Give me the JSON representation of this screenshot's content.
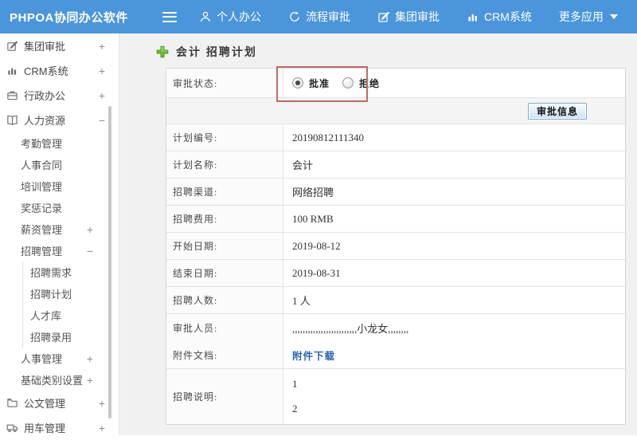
{
  "header": {
    "logo": "PHPOA协同办公软件",
    "nav": [
      {
        "id": "personal-office",
        "label": "个人办公",
        "icon": "person"
      },
      {
        "id": "workflow-approval",
        "label": "流程审批",
        "icon": "flow"
      },
      {
        "id": "group-approval",
        "label": "集团审批",
        "icon": "edit"
      },
      {
        "id": "crm-system",
        "label": "CRM系统",
        "icon": "chart"
      },
      {
        "id": "more-apps",
        "label": "更多应用",
        "icon": "caret-down"
      }
    ]
  },
  "sidebar": {
    "items": [
      {
        "id": "group-approval",
        "label": "集团审批",
        "level": 0,
        "icon": "edit",
        "toggle": "+"
      },
      {
        "id": "crm-system",
        "label": "CRM系统",
        "level": 0,
        "icon": "chart",
        "toggle": "+"
      },
      {
        "id": "admin-office",
        "label": "行政办公",
        "level": 0,
        "icon": "briefcase",
        "toggle": "+"
      },
      {
        "id": "human-resources",
        "label": "人力资源",
        "level": 0,
        "icon": "book",
        "toggle": "−"
      },
      {
        "id": "attendance-mgmt",
        "label": "考勤管理",
        "level": 1
      },
      {
        "id": "hr-contract",
        "label": "人事合同",
        "level": 1
      },
      {
        "id": "training-mgmt",
        "label": "培训管理",
        "level": 1
      },
      {
        "id": "reward-records",
        "label": "奖惩记录",
        "level": 1
      },
      {
        "id": "salary-mgmt",
        "label": "薪资管理",
        "level": 1,
        "toggle": "+"
      },
      {
        "id": "recruit-mgmt",
        "label": "招聘管理",
        "level": 1,
        "toggle": "−"
      },
      {
        "id": "recruit-demand",
        "label": "招聘需求",
        "level": 2
      },
      {
        "id": "recruit-plan",
        "label": "招聘计划",
        "level": 2
      },
      {
        "id": "talent-pool",
        "label": "人才库",
        "level": 2
      },
      {
        "id": "recruit-hire",
        "label": "招聘录用",
        "level": 2
      },
      {
        "id": "personnel-mgmt",
        "label": "人事管理",
        "level": 1,
        "toggle": "+"
      },
      {
        "id": "basic-category",
        "label": "基础类别设置",
        "level": 1,
        "toggle": "+"
      },
      {
        "id": "document-mgmt",
        "label": "公文管理",
        "level": 0,
        "icon": "doc",
        "toggle": "+"
      },
      {
        "id": "vehicle-mgmt",
        "label": "用车管理",
        "level": 0,
        "icon": "truck",
        "toggle": "+"
      }
    ]
  },
  "main": {
    "title": "会计 招聘计划",
    "form": {
      "status_label": "审批状态:",
      "radios": [
        {
          "label": "批准",
          "checked": true
        },
        {
          "label": "拒绝",
          "checked": false
        }
      ],
      "button": "审批信息",
      "rows": [
        {
          "label": "计划编号:",
          "value": "20190812111340"
        },
        {
          "label": "计划名称:",
          "value": "会计"
        },
        {
          "label": "招聘渠道:",
          "value": "网络招聘"
        },
        {
          "label": "招聘费用:",
          "value": "100 RMB"
        },
        {
          "label": "开始日期:",
          "value": "2019-08-12"
        },
        {
          "label": "结束日期:",
          "value": "2019-08-31"
        },
        {
          "label": "招聘人数:",
          "value": "1 人"
        },
        {
          "label": "审批人员:",
          "value": ",,,,,,,,,,,,,,,,,,,,,,,,,小龙女,,,,,,,,"
        }
      ],
      "attachment": {
        "label": "附件文档:",
        "link": "附件下载"
      },
      "description": {
        "label": "招聘说明:",
        "lines": [
          "1",
          "2"
        ]
      }
    }
  },
  "colors": {
    "header_blue": "#4b96da",
    "main_background": "#f1f1f1",
    "annotation_red": "#c06a68",
    "link_blue": "#2667b0",
    "plus_green": "#6abf30"
  }
}
